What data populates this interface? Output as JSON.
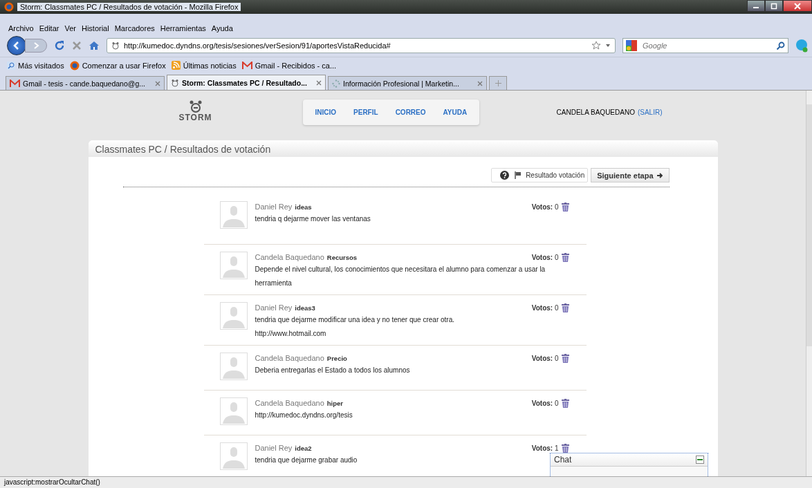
{
  "window": {
    "title": "Storm: Classmates PC / Resultados de votación - Mozilla Firefox"
  },
  "menu": [
    "Archivo",
    "Editar",
    "Ver",
    "Historial",
    "Marcadores",
    "Herramientas",
    "Ayuda"
  ],
  "address": {
    "value": "http://kumedoc.dyndns.org/tesis/sesiones/verSesion/91/aportesVistaReducida#"
  },
  "search": {
    "placeholder": "Google"
  },
  "bookmarks": [
    {
      "label": "Más visitados",
      "kind": "search"
    },
    {
      "label": "Comenzar a usar Firefox",
      "kind": "firefox"
    },
    {
      "label": "Últimas noticias",
      "kind": "rss"
    },
    {
      "label": "Gmail - Recibidos - ca...",
      "kind": "gmail"
    }
  ],
  "tabs": [
    {
      "label": "Gmail - tesis - cande.baquedano@g...",
      "kind": "gmail",
      "selected": false
    },
    {
      "label": "Storm: Classmates PC / Resultado...",
      "kind": "storm",
      "selected": true
    },
    {
      "label": "Información Profesional | Marketin...",
      "kind": "loading",
      "selected": false
    }
  ],
  "site": {
    "logo": "STORM",
    "nav": [
      "INICIO",
      "PERFIL",
      "CORREO",
      "AYUDA"
    ],
    "user": "CANDELA BAQUEDANO",
    "logout": "(SALIR)"
  },
  "panel": {
    "title": "Classmates PC / Resultados de votación",
    "result_button": "Resultado votación",
    "next_button": "Siguiente etapa"
  },
  "posts": [
    {
      "author": "Daniel Rey",
      "topic": "ideas",
      "votes_label": "Votos:",
      "votes": "0",
      "lines": [
        "tendria q dejarme mover las ventanas"
      ]
    },
    {
      "author": "Candela Baquedano",
      "topic": "Recursos",
      "votes_label": "Votos:",
      "votes": "0",
      "lines": [
        "Depende el nivel cultural, los conocimientos que necesitara el alumno para comenzar a usar la herramienta"
      ]
    },
    {
      "author": "Daniel Rey",
      "topic": "ideas3",
      "votes_label": "Votos:",
      "votes": "0",
      "lines": [
        "tendria que dejarme modificar una idea y no tener que crear otra.",
        "http://www.hotmail.com"
      ]
    },
    {
      "author": "Candela Baquedano",
      "topic": "Precio",
      "votes_label": "Votos:",
      "votes": "0",
      "lines": [
        "Deberia entregarlas el Estado a todos los alumnos"
      ]
    },
    {
      "author": "Candela Baquedano",
      "topic": "hiper",
      "votes_label": "Votos:",
      "votes": "0",
      "lines": [
        "http://kumedoc.dyndns.org/tesis"
      ]
    },
    {
      "author": "Daniel Rey",
      "topic": "idea2",
      "votes_label": "Votos:",
      "votes": "1",
      "lines": [
        "tendria que dejarme grabar audio"
      ]
    }
  ],
  "chat": {
    "title": "Chat"
  },
  "status_bar": "javascript:mostrarOcultarChat()"
}
